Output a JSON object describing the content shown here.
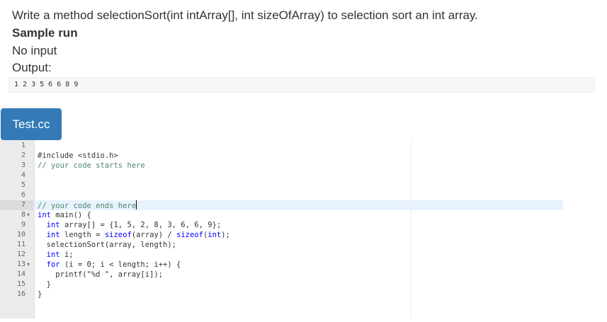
{
  "problem": {
    "statement": "Write a method selectionSort(int intArray[], int sizeOfArray) to selection sort an int array.",
    "sample_title": "Sample run",
    "input_text": "No input",
    "output_label": "Output:",
    "output_value": "1 2 3 5 6 6 8 9"
  },
  "editor": {
    "tab_label": "Test.cc",
    "line_numbers": [
      "1",
      "2",
      "3",
      "4",
      "5",
      "6",
      "7",
      "8",
      "9",
      "10",
      "11",
      "12",
      "13",
      "14",
      "15",
      "16"
    ],
    "lines": [
      "",
      "#include <stdio.h>",
      "// your code starts here",
      "",
      "",
      "",
      "// your code ends here",
      "int main() {",
      "  int array[] = {1, 5, 2, 8, 3, 6, 6, 9};",
      "  int length = sizeof(array) / sizeof(int);",
      "  selectionSort(array, length);",
      "  int i;",
      "  for (i = 0; i < length; i++) {",
      "    printf(\"%d \", array[i]);",
      "  }",
      "}"
    ],
    "active_line": 7,
    "fold_lines": [
      8,
      13
    ]
  }
}
